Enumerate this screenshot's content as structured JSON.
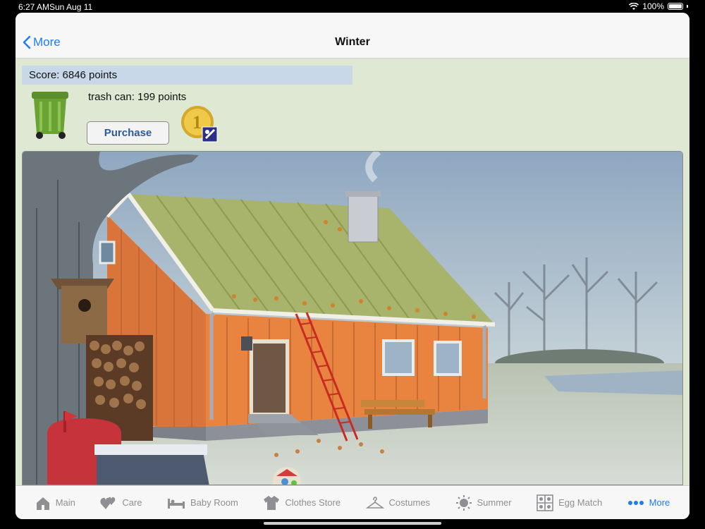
{
  "status": {
    "time": "6:27 AM",
    "date": "Sun Aug 11",
    "battery": "100%"
  },
  "nav": {
    "back_label": "More",
    "title": "Winter"
  },
  "score": {
    "text": "Score: 6846 points"
  },
  "item": {
    "text": "trash can: 199 points",
    "purchase_label": "Purchase"
  },
  "tabs": [
    {
      "label": "Main",
      "icon": "house-icon"
    },
    {
      "label": "Care",
      "icon": "hearts-icon"
    },
    {
      "label": "Baby Room",
      "icon": "bed-icon"
    },
    {
      "label": "Clothes Store",
      "icon": "shirt-icon"
    },
    {
      "label": "Costumes",
      "icon": "hanger-icon"
    },
    {
      "label": "Summer",
      "icon": "sun-icon"
    },
    {
      "label": "Egg Match",
      "icon": "grid-icon"
    },
    {
      "label": "More",
      "icon": "more-dots-icon"
    }
  ],
  "colors": {
    "accent": "#1e7cf2",
    "content_bg": "#dfe8d3",
    "score_bg": "#c8d8e8",
    "house": "#e8843f"
  }
}
